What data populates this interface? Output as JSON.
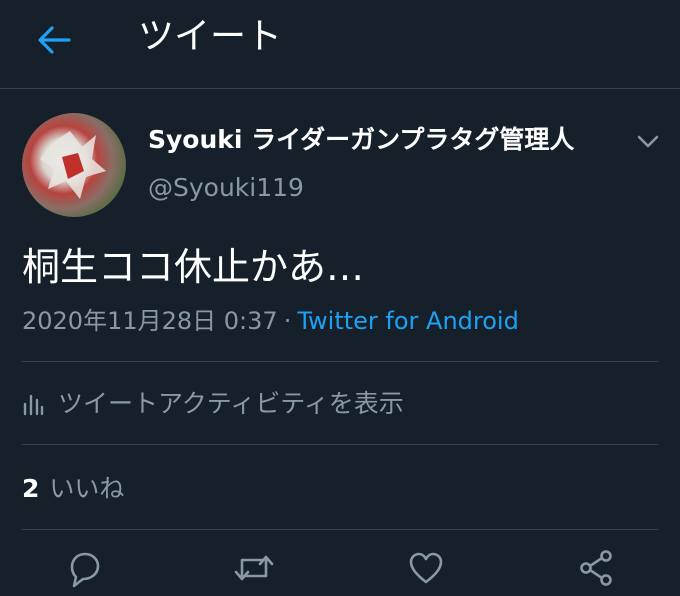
{
  "header": {
    "title": "ツイート",
    "back_icon": "arrow-left-icon",
    "accent_color": "#1da1f2"
  },
  "tweet": {
    "display_name": "Syouki ライダーガンプラタグ管理人",
    "handle": "@Syouki119",
    "text": "桐生ココ休止かあ…",
    "timestamp": "2020年11月28日 0:37",
    "separator": "·",
    "source": "Twitter for Android"
  },
  "activity": {
    "label": "ツイートアクティビティを表示",
    "icon": "bar-chart-icon"
  },
  "likes": {
    "count": "2",
    "label": "いいね"
  },
  "actions": [
    "reply-icon",
    "retweet-icon",
    "like-icon",
    "share-icon"
  ],
  "colors": {
    "background": "#15202b",
    "secondary_text": "#8899a6",
    "divider": "#38444d"
  }
}
